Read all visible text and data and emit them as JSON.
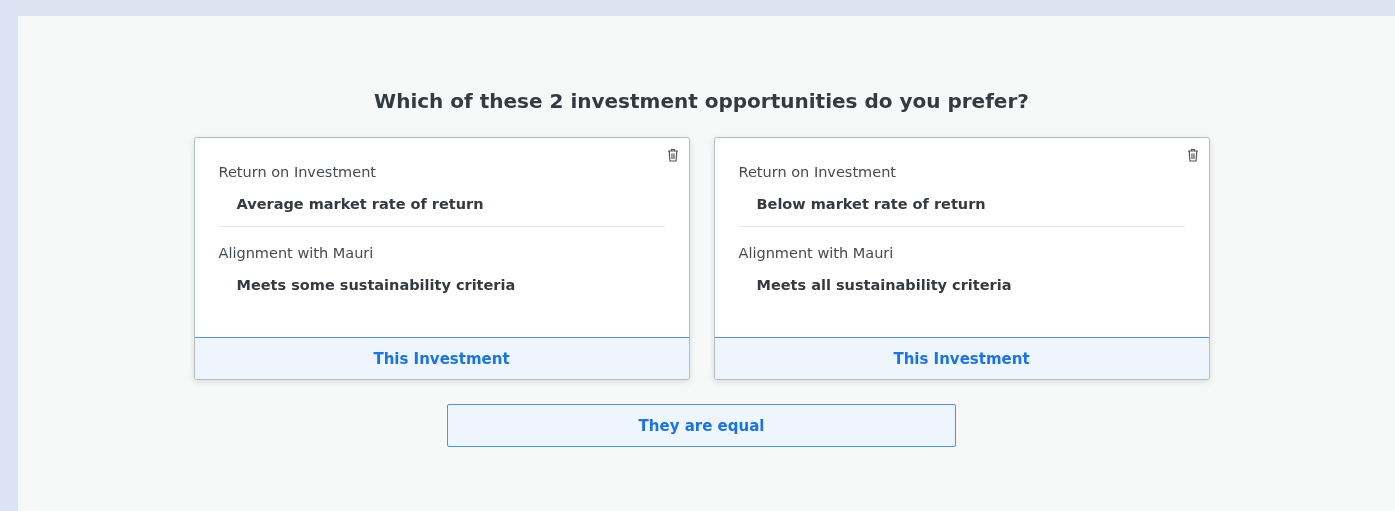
{
  "question": "Which of these 2 investment opportunities do you prefer?",
  "options": [
    {
      "attributes": [
        {
          "label": "Return on Investment",
          "value": "Average market rate of return"
        },
        {
          "label": "Alignment with Mauri",
          "value": "Meets some sustainability criteria"
        }
      ],
      "button": "This Investment"
    },
    {
      "attributes": [
        {
          "label": "Return on Investment",
          "value": "Below market rate of return"
        },
        {
          "label": "Alignment with Mauri",
          "value": "Meets all sustainability criteria"
        }
      ],
      "button": "This Investment"
    }
  ],
  "equal_button": "They are equal"
}
